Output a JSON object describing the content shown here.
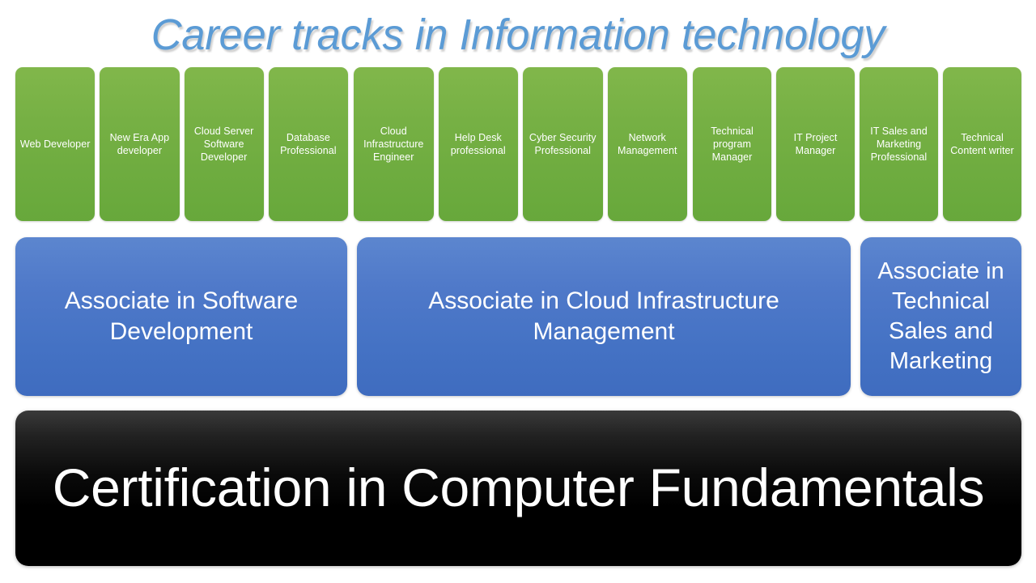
{
  "slide": {
    "title": "Career tracks in Information technology",
    "title_color": "#5B9BD5",
    "background_color": "#FFFFFF"
  },
  "career_tracks_row": {
    "box_fill_color": "#76B043",
    "box_text_color": "#FFFFFF",
    "groups": [
      {
        "group_name": "software-development-track",
        "boxes": [
          {
            "label": "Web Developer"
          },
          {
            "label": "New Era App developer"
          },
          {
            "label": "Cloud Server Software Developer"
          },
          {
            "label": "Database Professional"
          }
        ]
      },
      {
        "group_name": "cloud-infrastructure-track",
        "boxes": [
          {
            "label": "Cloud Infrastructure Engineer"
          },
          {
            "label": "Help Desk professional"
          },
          {
            "label": "Cyber Security Professional"
          },
          {
            "label": "Network Management"
          }
        ]
      },
      {
        "group_name": "technical-sales-marketing-track",
        "boxes": [
          {
            "label": "Technical program Manager"
          },
          {
            "label": "IT Project Manager"
          },
          {
            "label": "IT Sales and Marketing Professional"
          },
          {
            "label": "Technical Content writer"
          }
        ]
      }
    ]
  },
  "degrees_row": {
    "box_fill_color": "#4472C4",
    "box_text_color": "#FFFFFF",
    "boxes": [
      {
        "label": "Associate in Software Development"
      },
      {
        "label": "Associate in Cloud Infrastructure Management"
      },
      {
        "label": "Associate in Technical Sales and Marketing"
      }
    ]
  },
  "foundation_row": {
    "box_fill_color": "#000000",
    "box_text_color": "#FFFFFF",
    "label": "Certification in Computer Fundamentals"
  }
}
